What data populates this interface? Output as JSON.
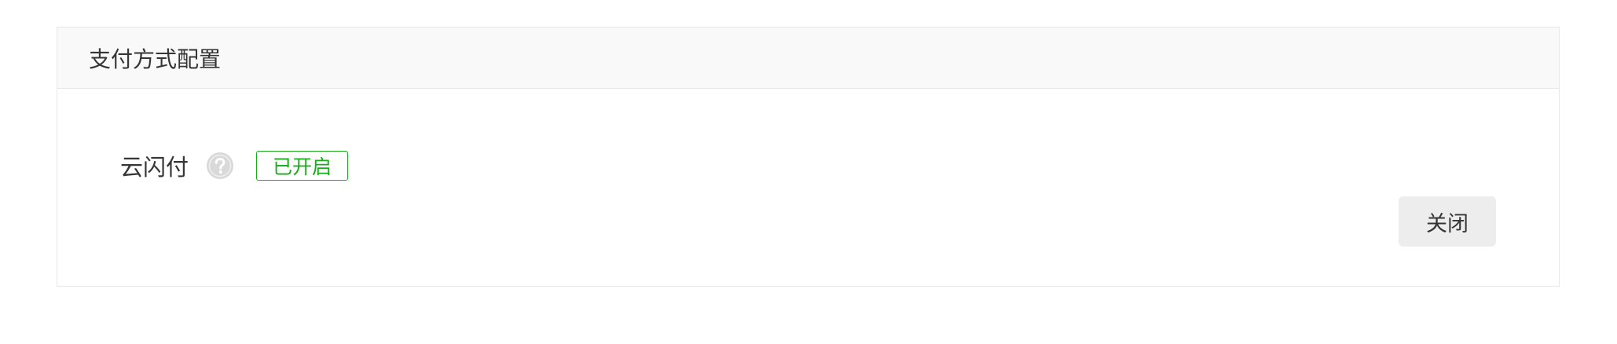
{
  "panel": {
    "title": "支付方式配置"
  },
  "payment_method": {
    "name": "云闪付",
    "help_icon": "question-circle-icon",
    "status": "已开启",
    "status_color": "#1aad19",
    "action_label": "关闭"
  }
}
